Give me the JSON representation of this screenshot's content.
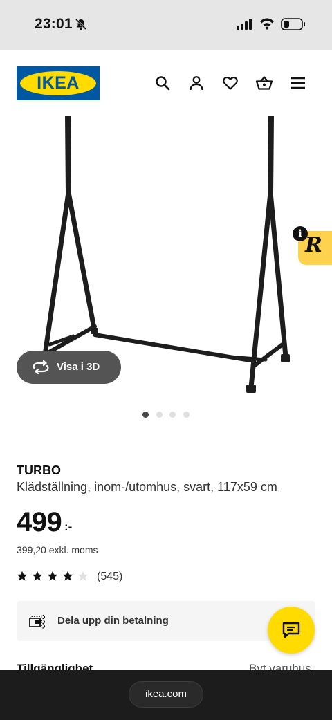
{
  "status_bar": {
    "time": "23:01",
    "icons": [
      "bell-slash-icon",
      "cellular-signal-icon",
      "wifi-icon",
      "battery-icon"
    ]
  },
  "header": {
    "logo_text": "IKEA",
    "icons": [
      "search-icon",
      "user-icon",
      "heart-icon",
      "basket-icon",
      "menu-icon"
    ],
    "colors": {
      "brand_blue": "#0058a3",
      "brand_yellow": "#ffdb00"
    }
  },
  "gallery": {
    "view_3d_label": "Visa i 3D",
    "slide_count": 4,
    "active_slide": 1
  },
  "product": {
    "name": "TURBO",
    "description": "Klädställning, inom-/utomhus, svart, ",
    "size": "117x59 cm",
    "price": "499",
    "price_suffix": ":-",
    "price_excl_vat": "399,20 exkl. moms",
    "rating": 4,
    "rating_max": 5,
    "review_count": "(545)"
  },
  "payment": {
    "label": "Dela upp din betalning"
  },
  "availability": {
    "heading": "Tillgänglighet",
    "change_store": "Byt varuhus"
  },
  "browser": {
    "url": "ikea.com"
  }
}
